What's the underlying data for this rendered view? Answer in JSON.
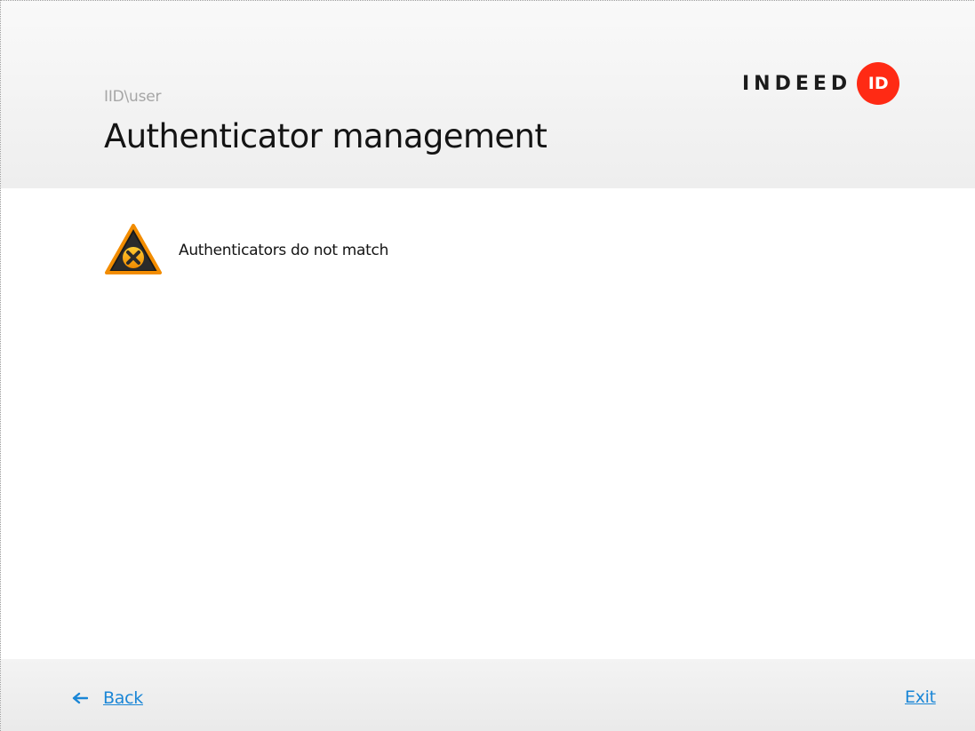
{
  "header": {
    "user": "IID\\user",
    "title": "Authenticator management",
    "logo": {
      "text": "INDEED",
      "badge": "ID",
      "badge_color": "#ff2a14"
    }
  },
  "content": {
    "status_icon": "warning-icon",
    "message": "Authenticators do not match"
  },
  "footer": {
    "back_label": "Back",
    "back_icon": "arrow-left-icon",
    "exit_label": "Exit",
    "link_color": "#1a86d6"
  }
}
